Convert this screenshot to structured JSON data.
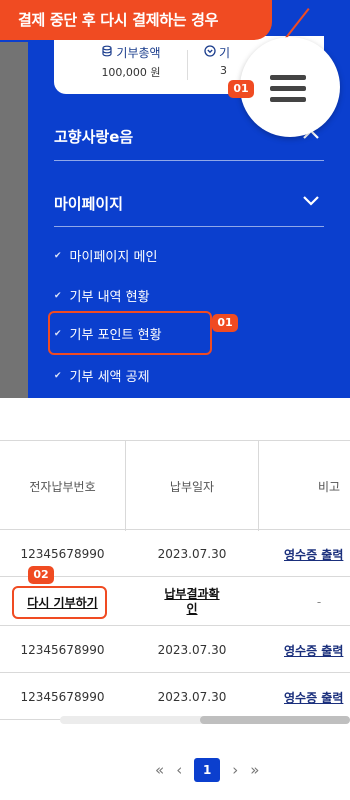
{
  "title_tag": "결제 중단 후 다시 결제하는 경우",
  "summary": {
    "col1_label": "기부총액",
    "col1_value": "100,000 원",
    "col2_label": "기",
    "col2_value": "3"
  },
  "menu": {
    "section1": "고향사랑e음",
    "section2": "마이페이지",
    "items": [
      "마이페이지 메인",
      "기부 내역 현황",
      "기부 포인트 현황",
      "기부 세액 공제"
    ]
  },
  "badges": {
    "b1": "01",
    "b2": "01",
    "b3": "02"
  },
  "table": {
    "headers": [
      "전자납부번호",
      "납부일자",
      "비고"
    ],
    "rows": [
      {
        "id": "12345678990",
        "date": "2023.07.30",
        "note": "영수증 출력"
      },
      {
        "id": "다시 기부하기",
        "date": "납부결과확인",
        "note": "-"
      },
      {
        "id": "12345678990",
        "date": "2023.07.30",
        "note": "영수증 출력"
      },
      {
        "id": "12345678990",
        "date": "2023.07.30",
        "note": "영수증 출력"
      }
    ]
  },
  "pagination": {
    "current": "1",
    "first": "«",
    "prev": "‹",
    "next": "›",
    "last": "»"
  },
  "colors": {
    "accent": "#f04b22",
    "brand_blue": "#0b3fce"
  }
}
